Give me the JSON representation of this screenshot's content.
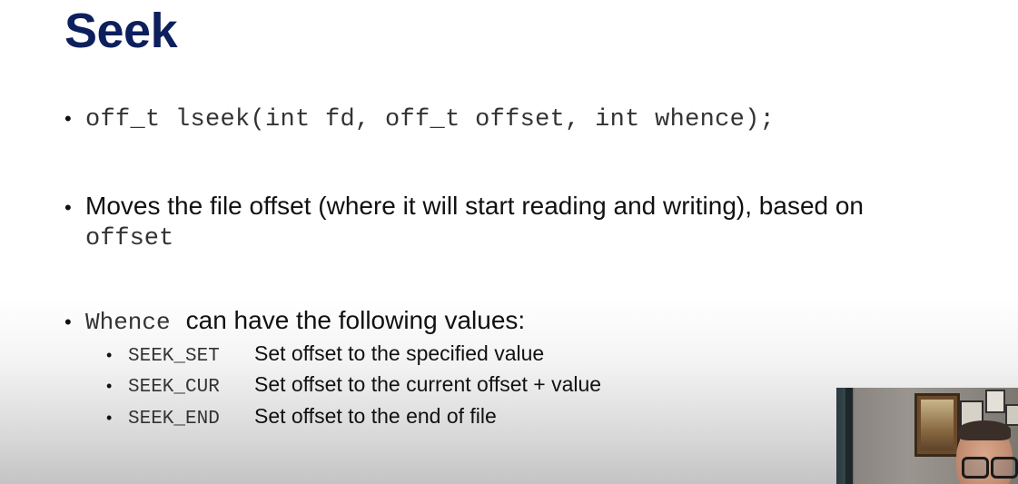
{
  "slide": {
    "title": "Seek",
    "bullets": [
      {
        "code": "off_t lseek(int fd, off_t offset, int whence);"
      },
      {
        "text": "Moves the file offset (where it will start reading and writing), based on",
        "code": "offset"
      },
      {
        "code": "Whence",
        "text": "can have the following values:",
        "sub_items": [
          {
            "code": "SEEK_SET",
            "text": "Set offset to the specified value"
          },
          {
            "code": "SEEK_CUR",
            "text": "Set offset to the current offset + value"
          },
          {
            "code": "SEEK_END",
            "text": "Set offset to the end of file"
          }
        ]
      }
    ]
  },
  "colors": {
    "title": "#0d1f5c",
    "text": "#111111",
    "code": "#333333"
  },
  "video_overlay": {
    "icon": "presenter-webcam"
  }
}
